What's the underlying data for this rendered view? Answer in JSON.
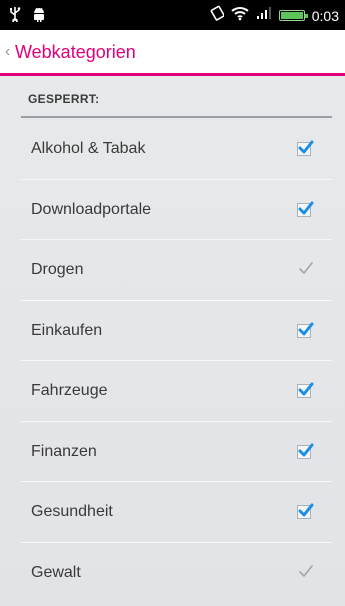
{
  "status_bar": {
    "time": "0:03",
    "icons": [
      "usb-icon",
      "android-debug-icon",
      "rotate-icon",
      "wifi-icon",
      "signal-icon",
      "battery-icon"
    ]
  },
  "header": {
    "back_glyph": "‹",
    "title": "Webkategorien",
    "accent_color": "#e2007a"
  },
  "section": {
    "title": "GESPERRT:"
  },
  "items": [
    {
      "label": "Alkohol & Tabak",
      "checked": true,
      "enabled": true
    },
    {
      "label": "Downloadportale",
      "checked": true,
      "enabled": true
    },
    {
      "label": "Drogen",
      "checked": true,
      "enabled": false
    },
    {
      "label": "Einkaufen",
      "checked": true,
      "enabled": true
    },
    {
      "label": "Fahrzeuge",
      "checked": true,
      "enabled": true
    },
    {
      "label": "Finanzen",
      "checked": true,
      "enabled": true
    },
    {
      "label": "Gesundheit",
      "checked": true,
      "enabled": true
    },
    {
      "label": "Gewalt",
      "checked": true,
      "enabled": false
    }
  ]
}
